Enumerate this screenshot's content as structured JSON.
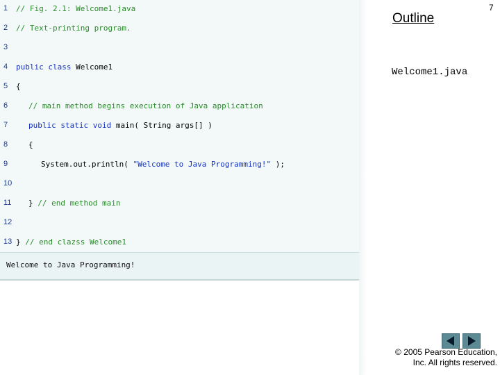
{
  "slide": {
    "number": "7",
    "outline": "Outline",
    "filename": "Welcome1.java"
  },
  "code_lines": [
    {
      "n": "1",
      "text": "// Fig. 2.1: Welcome1.java"
    },
    {
      "n": "2",
      "text": "// Text-printing program."
    },
    {
      "n": "3",
      "text": ""
    },
    {
      "n": "4",
      "kw": "public class ",
      "text": "Welcome1"
    },
    {
      "n": "5",
      "text": "{"
    },
    {
      "n": "6",
      "text": "// main method begins execution of Java application"
    },
    {
      "n": "7",
      "kw": "public static void ",
      "text": "main( String args[] )"
    },
    {
      "n": "8",
      "text": "{"
    },
    {
      "n": "9",
      "pre": "System.out.println( ",
      "str": "\"Welcome to Java Programming!\"",
      "post": " );"
    },
    {
      "n": "10",
      "text": ""
    },
    {
      "n": "11",
      "pre": "} ",
      "comment": "// end method main"
    },
    {
      "n": "12",
      "text": ""
    },
    {
      "n": "13",
      "pre": "} ",
      "comment": "// end clazss Welcome1"
    }
  ],
  "output": "Welcome to Java Programming!",
  "nav": {
    "prev": "previous-slide",
    "next": "next-slide"
  },
  "copyright": {
    "line1": "© 2005 Pearson Education,",
    "line2": "Inc.  All rights reserved."
  }
}
